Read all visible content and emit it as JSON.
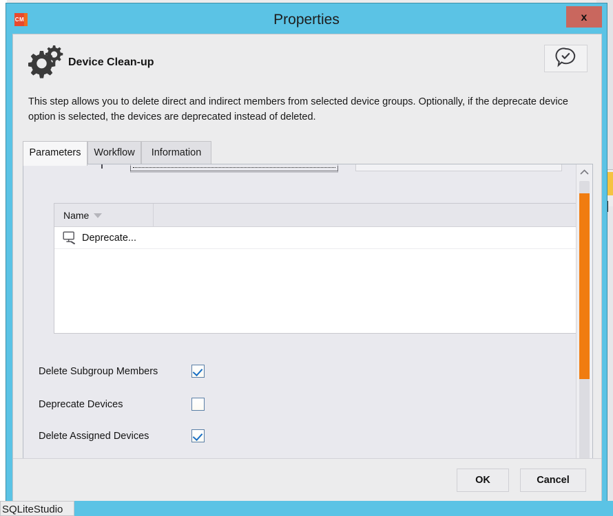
{
  "window": {
    "title": "Properties",
    "app_icon": "cm-icon",
    "app_icon_text": "CM",
    "close_label": "x",
    "titlebar_color": "#5bc3e5",
    "close_button_color": "#c9675e"
  },
  "header": {
    "step_title": "Device Clean-up",
    "icon": "gears-icon",
    "help_icon": "comment-check-icon"
  },
  "description": "This step allows you to delete direct and indirect members from selected device groups. Optionally, if the deprecate device option is selected, the devices are deprecated instead of deleted.",
  "tabs": [
    {
      "label": "Parameters",
      "active": true
    },
    {
      "label": "Workflow",
      "active": false
    },
    {
      "label": "Information",
      "active": false
    }
  ],
  "list": {
    "columns": [
      "Name",
      ""
    ],
    "sort_column": "Name",
    "sort_direction": "descending",
    "rows": [
      {
        "icon": "device-monitor-icon",
        "name": "Deprecate..."
      }
    ]
  },
  "checkboxes": [
    {
      "label": "Delete Subgroup Members",
      "checked": true
    },
    {
      "label": "Deprecate Devices",
      "checked": false
    },
    {
      "label": "Delete Assigned Devices",
      "checked": true
    }
  ],
  "scrollbars": {
    "vertical_thumb_color": "#f07c10",
    "horizontal_thumb_color": "#9a9a9e",
    "up_arrow": "chevron-up-icon",
    "down_arrow": "chevron-down-icon",
    "left_arrow": "chevron-left-icon",
    "right_arrow": "chevron-right-icon"
  },
  "footer": {
    "ok_label": "OK",
    "cancel_label": "Cancel"
  },
  "taskbar": {
    "item_label": "SQLiteStudio",
    "color": "#5bc3e5"
  }
}
